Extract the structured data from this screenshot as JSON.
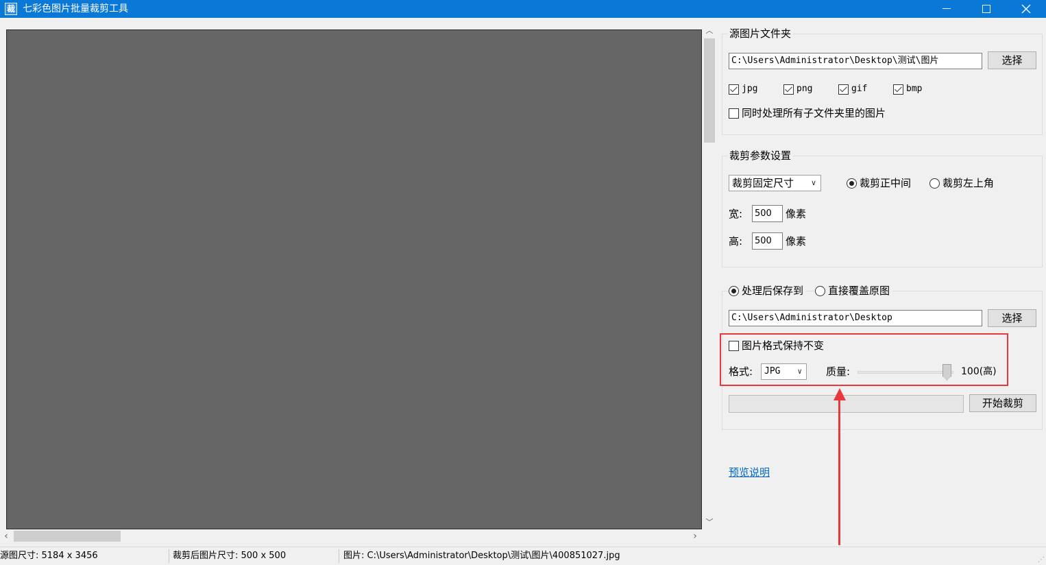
{
  "window": {
    "icon_char": "裁",
    "title": "七彩色图片批量裁剪工具",
    "minimize": "—",
    "maximize": "□",
    "close": "✕"
  },
  "source": {
    "group_title": "源图片文件夹",
    "path": "C:\\Users\\Administrator\\Desktop\\测试\\图片",
    "select_button": "选择",
    "formats": [
      {
        "label": "jpg",
        "checked": true
      },
      {
        "label": "png",
        "checked": true
      },
      {
        "label": "gif",
        "checked": true
      },
      {
        "label": "bmp",
        "checked": true
      }
    ],
    "include_subfolders": {
      "label": "同时处理所有子文件夹里的图片",
      "checked": false
    }
  },
  "crop": {
    "group_title": "裁剪参数设置",
    "mode_selected": "裁剪固定尺寸",
    "position_options": [
      {
        "label": "裁剪正中间",
        "selected": true
      },
      {
        "label": "裁剪左上角",
        "selected": false
      }
    ],
    "width_label": "宽:",
    "width_value": "500",
    "height_label": "高:",
    "height_value": "500",
    "unit": "像素"
  },
  "output": {
    "save_options": [
      {
        "label": "处理后保存到",
        "selected": true
      },
      {
        "label": "直接覆盖原图",
        "selected": false
      }
    ],
    "path": "C:\\Users\\Administrator\\Desktop",
    "select_button": "选择",
    "keep_format": {
      "label": "图片格式保持不变",
      "checked": false
    },
    "format_label": "格式:",
    "format_value": "JPG",
    "quality_label": "质量:",
    "quality_value": 100,
    "quality_text": "100(高)",
    "start_button": "开始裁剪",
    "progress": 0
  },
  "preview_link": "预览说明",
  "status": {
    "source_size": "源图尺寸: 5184 x 3456",
    "cropped_size": "裁剪后图片尺寸: 500 x 500",
    "image_path": "图片: C:\\Users\\Administrator\\Desktop\\测试\\图片\\400851027.jpg"
  },
  "colors": {
    "titlebar": "#0a78d7",
    "preview_bg": "#666666",
    "highlight": "#e8383d",
    "link": "#0066cc"
  }
}
